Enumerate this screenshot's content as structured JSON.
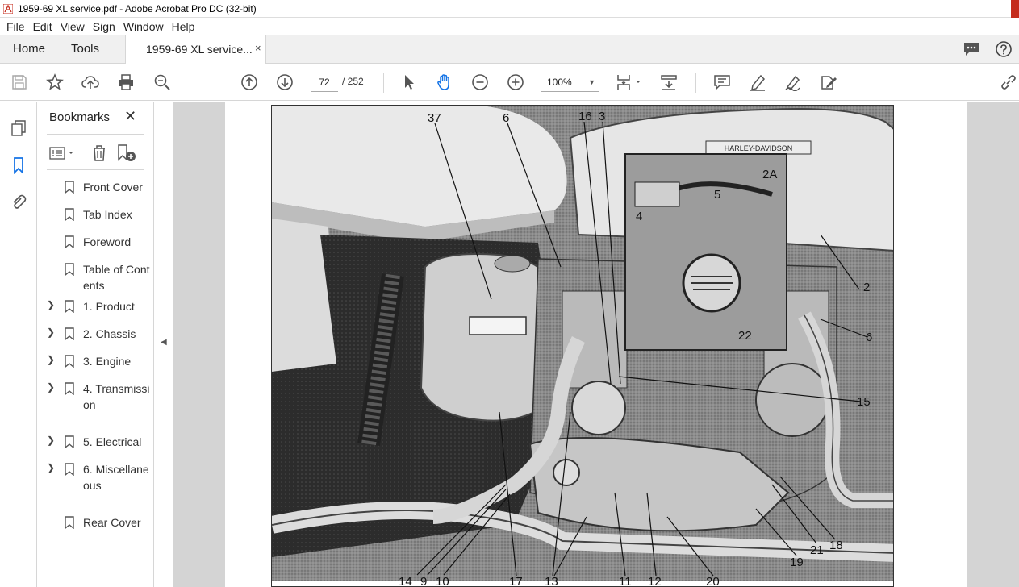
{
  "window": {
    "title": "1959-69 XL service.pdf - Adobe Acrobat Pro DC (32-bit)"
  },
  "menu": [
    "File",
    "Edit",
    "View",
    "Sign",
    "Window",
    "Help"
  ],
  "tabs": {
    "home": "Home",
    "tools": "Tools",
    "document": "1959-69 XL service...",
    "close": "×"
  },
  "toolbar": {
    "page_current": "72",
    "page_total": "/ 252",
    "zoom": "100%"
  },
  "bookmarks": {
    "header": "Bookmarks",
    "close": "✕",
    "items": [
      {
        "label": "Front Cover",
        "expandable": false
      },
      {
        "label": "Tab Index",
        "expandable": false
      },
      {
        "label": "Foreword",
        "expandable": false
      },
      {
        "label": "Table of Contents",
        "expandable": false
      },
      {
        "label": "1. Product",
        "expandable": true
      },
      {
        "label": "2. Chassis",
        "expandable": true
      },
      {
        "label": "3. Engine",
        "expandable": true
      },
      {
        "label": "4. Transmission",
        "expandable": true
      },
      {
        "label": "5. Electrical",
        "expandable": true
      },
      {
        "label": "6. Miscellaneous",
        "expandable": true
      },
      {
        "label": "Rear Cover",
        "expandable": false
      }
    ]
  },
  "figure": {
    "tank_badge": "HARLEY-DAVIDSON",
    "callouts": [
      "37",
      "6",
      "16",
      "3",
      "2A",
      "5",
      "4",
      "2",
      "6",
      "22",
      "15",
      "14",
      "9",
      "10",
      "17",
      "13",
      "11",
      "12",
      "20",
      "19",
      "21",
      "18"
    ]
  },
  "colors": {
    "accent": "#1473e6",
    "close": "#c42b1c"
  }
}
